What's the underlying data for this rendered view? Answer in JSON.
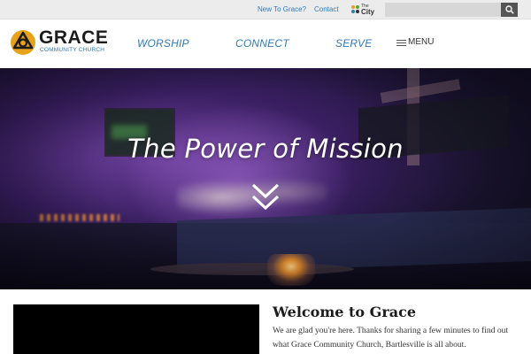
{
  "topbar": {
    "links": [
      "New To Grace?",
      "Contact"
    ],
    "thecity": {
      "small": "The",
      "big": "City"
    },
    "search": {
      "value": "",
      "placeholder": ""
    }
  },
  "header": {
    "logo": {
      "title": "GRACE",
      "subtitle": "COMMUNITY CHURCH"
    },
    "nav": [
      "WORSHIP",
      "CONNECT",
      "SERVE"
    ],
    "menu_label": "MENU"
  },
  "hero": {
    "title": "The Power of Mission"
  },
  "welcome": {
    "title": "Welcome to Grace",
    "text": "We are glad you're here.  Thanks for sharing a few minutes to find out what Grace Community Church, Bartlesville is all about."
  },
  "colors": {
    "link_blue": "#2f7ab8",
    "logo_gold": "#e7a21a",
    "dark_text": "#1c1c1c"
  },
  "icons": [
    "search-icon",
    "the-city-logo-icon",
    "grace-logo-icon",
    "hamburger-icon",
    "chevron-double-down-icon"
  ]
}
